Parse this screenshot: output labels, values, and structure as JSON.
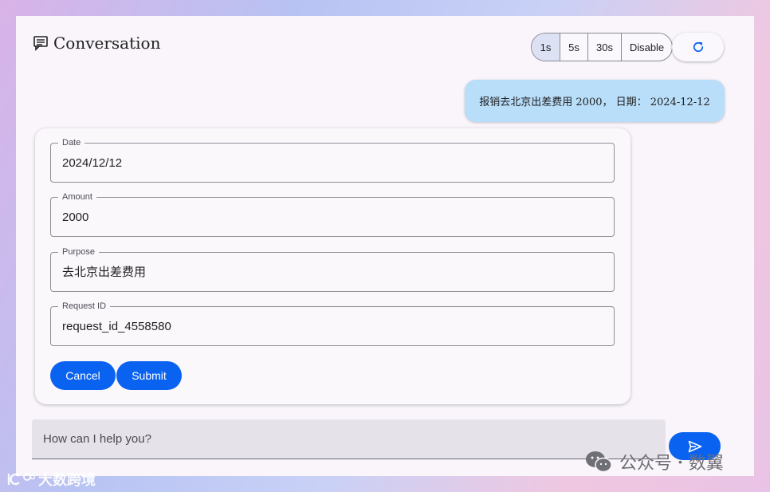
{
  "header": {
    "title": "Conversation",
    "title_icon": "chat-message-icon",
    "intervals": [
      "1s",
      "5s",
      "30s",
      "Disable"
    ],
    "selected_interval": "1s",
    "refresh_icon": "refresh-icon"
  },
  "user_message": "报销去北京出差费用 2000， 日期： 2024-12-12",
  "form": {
    "fields": [
      {
        "label": "Date",
        "value": "2024/12/12"
      },
      {
        "label": "Amount",
        "value": "2000"
      },
      {
        "label": "Purpose",
        "value": "去北京出差费用"
      },
      {
        "label": "Request ID",
        "value": "request_id_4558580"
      }
    ],
    "cancel_label": "Cancel",
    "submit_label": "Submit"
  },
  "chat_input": {
    "placeholder": "How can I help you?",
    "send_icon": "send-icon"
  },
  "watermarks": {
    "left": "大数跨境",
    "right_account": "公众号",
    "right_name": "数翼"
  },
  "colors": {
    "accent": "#0a63f0",
    "user_bubble": "#b9defa",
    "panel": "#f9f5fb",
    "selected_segment": "#dde1f4"
  }
}
